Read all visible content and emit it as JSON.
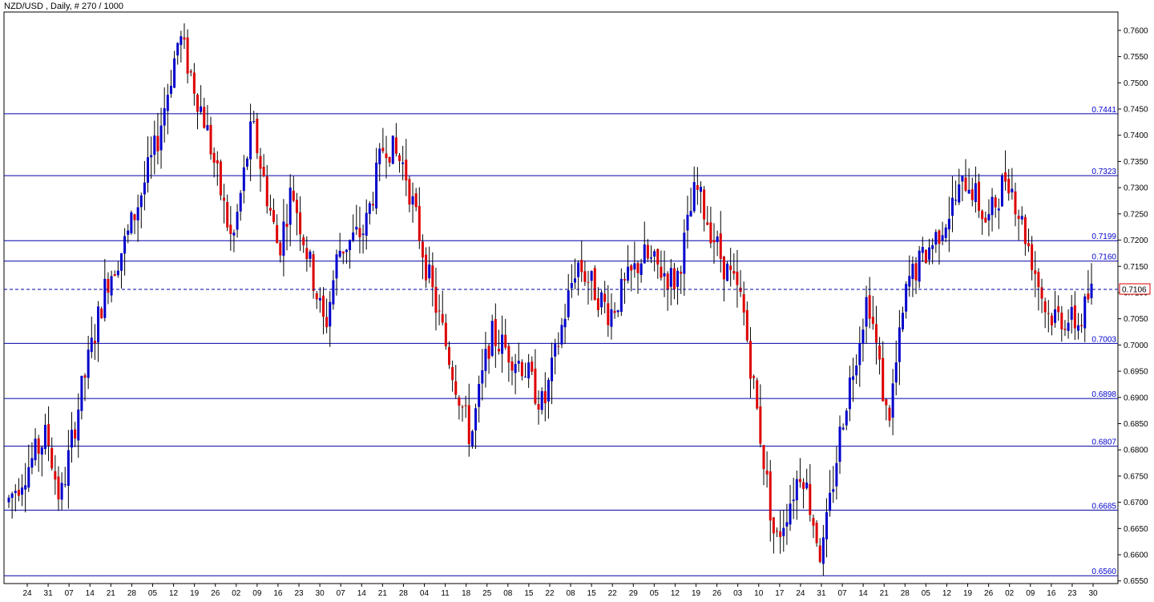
{
  "window": {
    "title": "NZD/USD , Daily, # 270 / 1000"
  },
  "colors": {
    "bull": "#0000cc",
    "bear": "#dd0000",
    "level": "#0000aa",
    "frame": "#000000",
    "current_price_box": "#dd0000"
  },
  "chart_data": {
    "type": "candlestick",
    "symbol": "NZD/USD",
    "timeframe": "Daily",
    "ylim": [
      0.6545,
      0.7635
    ],
    "y_ticks": [
      "0.7600",
      "0.7550",
      "0.7500",
      "0.7450",
      "0.7400",
      "0.7350",
      "0.7300",
      "0.7250",
      "0.7200",
      "0.7150",
      "0.7100",
      "0.7050",
      "0.7000",
      "0.6950",
      "0.6900",
      "0.6850",
      "0.6800",
      "0.6750",
      "0.6700",
      "0.6650",
      "0.6600",
      "0.6550"
    ],
    "x_ticks": [
      "24",
      "31",
      "07",
      "14",
      "21",
      "28",
      "05",
      "12",
      "19",
      "26",
      "02",
      "09",
      "16",
      "23",
      "30",
      "07",
      "14",
      "21",
      "28",
      "04",
      "11",
      "18",
      "25",
      "08",
      "15",
      "22",
      "08",
      "15",
      "22",
      "29",
      "05",
      "12",
      "19",
      "26",
      "03",
      "10",
      "17",
      "24",
      "31",
      "07",
      "14",
      "21",
      "28",
      "05",
      "12",
      "19",
      "26",
      "02",
      "09",
      "16",
      "23",
      "30"
    ],
    "levels": [
      {
        "value": 0.7441,
        "label": "0.7441"
      },
      {
        "value": 0.7323,
        "label": "0.7323"
      },
      {
        "value": 0.7199,
        "label": "0.7199"
      },
      {
        "value": 0.716,
        "label": "0.7160"
      },
      {
        "value": 0.7003,
        "label": "0.7003"
      },
      {
        "value": 0.6898,
        "label": "0.6898"
      },
      {
        "value": 0.6807,
        "label": "0.6807"
      },
      {
        "value": 0.6685,
        "label": "0.6685"
      },
      {
        "value": 0.656,
        "label": "0.6560"
      }
    ],
    "current_price": {
      "value": 0.7106,
      "label": "0.7106"
    },
    "anchors": [
      [
        0,
        0.67
      ],
      [
        12,
        0.683
      ],
      [
        16,
        0.67
      ],
      [
        22,
        0.69
      ],
      [
        30,
        0.712
      ],
      [
        36,
        0.72
      ],
      [
        45,
        0.738
      ],
      [
        52,
        0.759
      ],
      [
        60,
        0.742
      ],
      [
        68,
        0.719
      ],
      [
        74,
        0.742
      ],
      [
        82,
        0.718
      ],
      [
        86,
        0.73
      ],
      [
        96,
        0.703
      ],
      [
        100,
        0.718
      ],
      [
        108,
        0.722
      ],
      [
        114,
        0.739
      ],
      [
        120,
        0.734
      ],
      [
        128,
        0.711
      ],
      [
        140,
        0.682
      ],
      [
        146,
        0.702
      ],
      [
        156,
        0.696
      ],
      [
        162,
        0.688
      ],
      [
        172,
        0.716
      ],
      [
        182,
        0.706
      ],
      [
        192,
        0.717
      ],
      [
        202,
        0.712
      ],
      [
        208,
        0.73
      ],
      [
        216,
        0.716
      ],
      [
        222,
        0.708
      ],
      [
        232,
        0.662
      ],
      [
        240,
        0.677
      ],
      [
        246,
        0.659
      ],
      [
        252,
        0.685
      ],
      [
        260,
        0.71
      ],
      [
        266,
        0.685
      ],
      [
        272,
        0.712
      ],
      [
        280,
        0.72
      ],
      [
        290,
        0.732
      ],
      [
        296,
        0.723
      ],
      [
        302,
        0.733
      ],
      [
        308,
        0.72
      ],
      [
        314,
        0.706
      ],
      [
        320,
        0.705
      ],
      [
        324,
        0.704
      ],
      [
        327,
        0.71
      ]
    ]
  }
}
